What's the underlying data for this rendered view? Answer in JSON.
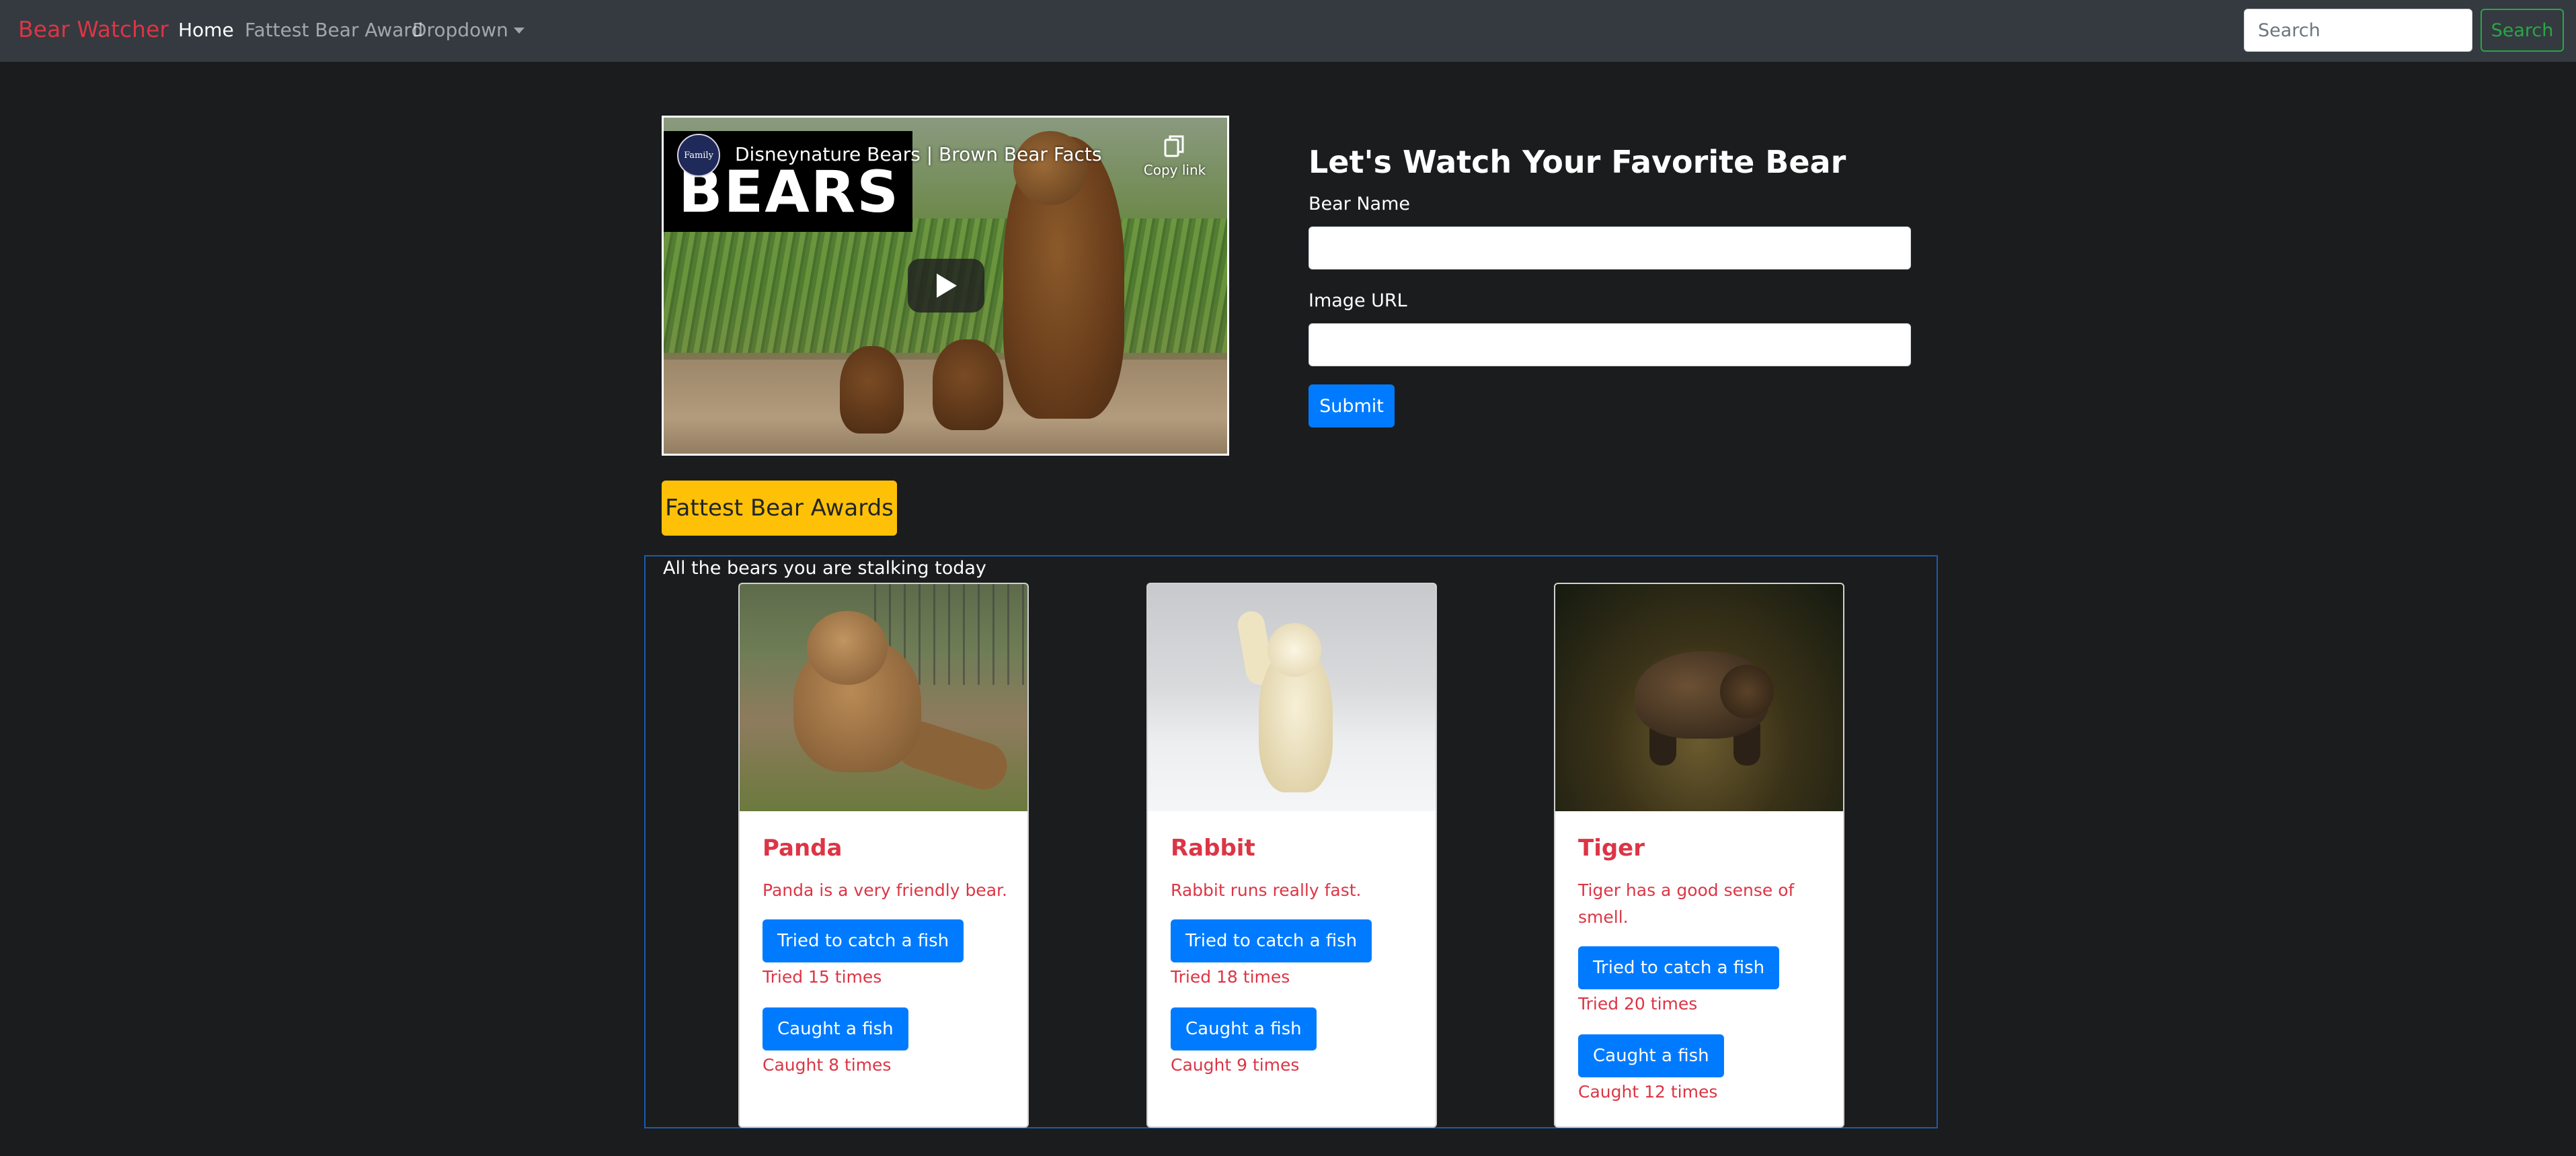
{
  "navbar": {
    "brand": "Bear Watcher",
    "links": [
      {
        "label": "Home",
        "active": true
      },
      {
        "label": "Fattest Bear Award",
        "active": false
      },
      {
        "label": "Dropdown",
        "active": false
      }
    ],
    "search": {
      "placeholder": "Search",
      "button_label": "Search"
    }
  },
  "video": {
    "channel": "Family",
    "title": "Disneynature Bears | Brown Bear Facts",
    "thumbnail_text": "BEARS",
    "copy_link_label": "Copy link"
  },
  "form": {
    "title": "Let's Watch Your Favorite Bear",
    "name_label": "Bear Name",
    "name_value": "",
    "url_label": "Image URL",
    "url_value": "",
    "submit_label": "Submit"
  },
  "awards_button_label": "Fattest Bear Awards",
  "bears_section": {
    "caption": "All the bears you are stalking today",
    "cards": [
      {
        "name": "Panda",
        "description": "Panda is a very friendly bear.",
        "try_button": "Tried to catch a fish",
        "tried_text": "Tried 15 times",
        "catch_button": "Caught a fish",
        "caught_text": "Caught 8 times"
      },
      {
        "name": "Rabbit",
        "description": "Rabbit runs really fast.",
        "try_button": "Tried to catch a fish",
        "tried_text": "Tried 18 times",
        "catch_button": "Caught a fish",
        "caught_text": "Caught 9 times"
      },
      {
        "name": "Tiger",
        "description": "Tiger has a good sense of smell.",
        "try_button": "Tried to catch a fish",
        "tried_text": "Tried 20 times",
        "catch_button": "Caught a fish",
        "caught_text": "Caught 12 times"
      }
    ]
  },
  "colors": {
    "background": "#1b1c1d",
    "navbar": "#343a40",
    "brand": "#dc3545",
    "primary": "#007bff",
    "warning": "#ffc107",
    "success": "#28a745"
  }
}
